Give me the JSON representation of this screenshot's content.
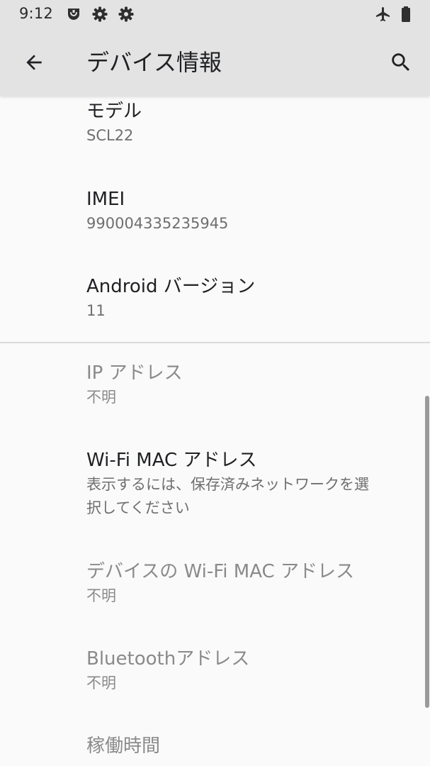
{
  "status_bar": {
    "time": "9:12",
    "icons_left": [
      "notification-app-icon",
      "gear-icon",
      "gear-icon"
    ],
    "icons_right": [
      "airplane-mode-icon",
      "battery-icon"
    ]
  },
  "app_bar": {
    "title": "デバイス情報",
    "back_icon": "arrow-back-icon",
    "search_icon": "search-icon"
  },
  "items": [
    {
      "title": "モデル",
      "summary": "SCL22",
      "enabled": true
    },
    {
      "title": "IMEI",
      "summary": "990004335235945",
      "enabled": true
    },
    {
      "title": "Android バージョン",
      "summary": "11",
      "enabled": true
    },
    {
      "title": "IP アドレス",
      "summary": "不明",
      "enabled": false
    },
    {
      "title": "Wi-Fi MAC アドレス",
      "summary_line1": "表示するには、保存済みネットワークを選",
      "summary_line2": "択してください",
      "enabled": true
    },
    {
      "title": "デバイスの Wi-Fi MAC アドレス",
      "summary": "不明",
      "enabled": false
    },
    {
      "title": "Bluetoothアドレス",
      "summary": "不明",
      "enabled": false
    },
    {
      "title": "稼働時間",
      "enabled": false
    }
  ],
  "colors": {
    "app_bar_bg": "#e3e3e3",
    "background": "#fafafa",
    "primary_text": "#202124",
    "secondary_text": "#6f6f6f",
    "disabled_text": "#8a8a8a"
  }
}
